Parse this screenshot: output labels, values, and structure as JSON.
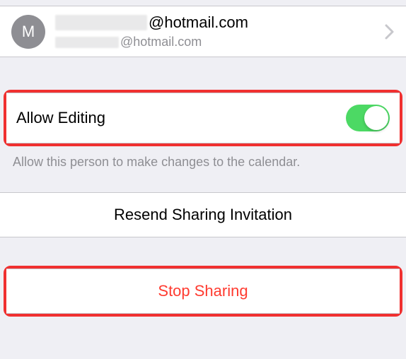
{
  "contact": {
    "avatar_initial": "M",
    "primary_suffix": "@hotmail.com",
    "secondary_suffix": "@hotmail.com"
  },
  "allow_editing": {
    "label": "Allow Editing",
    "footer": "Allow this person to make changes to the calendar.",
    "enabled": true
  },
  "actions": {
    "resend": "Resend Sharing Invitation",
    "stop": "Stop Sharing"
  },
  "colors": {
    "destructive": "#ff3b30",
    "toggle_on": "#4cd964",
    "highlight_border": "#f03030"
  }
}
